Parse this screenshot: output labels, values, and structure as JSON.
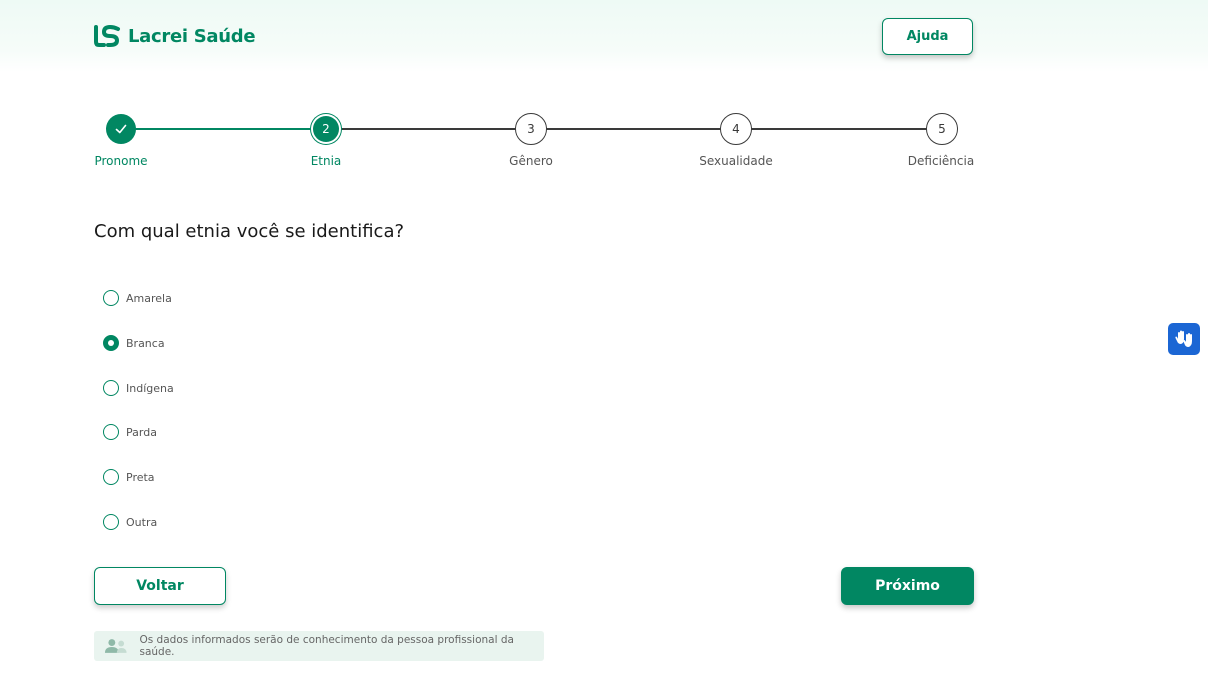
{
  "header": {
    "brand_name": "Lacrei Saúde",
    "help_label": "Ajuda"
  },
  "stepper": {
    "current_step": 2,
    "steps": [
      {
        "number": "1",
        "label": "Pronome",
        "state": "done",
        "icon": "check-icon"
      },
      {
        "number": "2",
        "label": "Etnia",
        "state": "current"
      },
      {
        "number": "3",
        "label": "Gênero",
        "state": "todo"
      },
      {
        "number": "4",
        "label": "Sexualidade",
        "state": "todo"
      },
      {
        "number": "5",
        "label": "Deficiência",
        "state": "todo"
      }
    ]
  },
  "form": {
    "question": "Com qual etnia você se identifica?",
    "selected": "Branca",
    "options": [
      "Amarela",
      "Branca",
      "Indígena",
      "Parda",
      "Preta",
      "Outra"
    ]
  },
  "actions": {
    "back_label": "Voltar",
    "next_label": "Próximo"
  },
  "notice": {
    "icon": "users-icon",
    "text": "Os dados informados serão de conhecimento da pessoa profissional da saúde."
  },
  "accessibility": {
    "icon": "sign-language-hands-icon"
  },
  "colors": {
    "brand_green": "#018762",
    "notice_bg": "#e9f4ef",
    "accessibility_blue": "#1b66d4"
  }
}
